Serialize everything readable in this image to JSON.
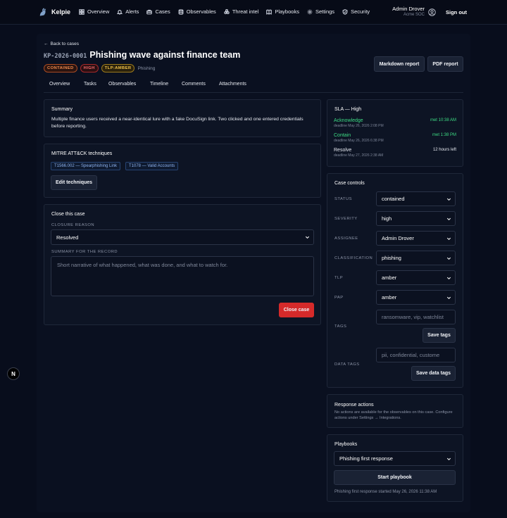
{
  "nav": {
    "brand": "Kelpie",
    "items": [
      {
        "label": "Overview",
        "icon": "grid-icon"
      },
      {
        "label": "Alerts",
        "icon": "bell-icon"
      },
      {
        "label": "Cases",
        "icon": "briefcase-icon"
      },
      {
        "label": "Observables",
        "icon": "database-icon"
      },
      {
        "label": "Threat intel",
        "icon": "biohazard-icon"
      },
      {
        "label": "Playbooks",
        "icon": "book-icon"
      },
      {
        "label": "Settings",
        "icon": "gear-icon"
      },
      {
        "label": "Security",
        "icon": "shield-icon"
      }
    ],
    "user_name": "Admin Drover",
    "user_org": "Acme SOC",
    "sign_out": "Sign out"
  },
  "case": {
    "back": "Back to cases",
    "id": "KP-2026-0001",
    "title": "Phishing wave against finance team",
    "badges": [
      "CONTAINED",
      "HIGH",
      "TLP:AMBER"
    ],
    "category": "Phishing"
  },
  "header_actions": {
    "markdown": "Markdown report",
    "pdf": "PDF report"
  },
  "tabs": [
    "Overview",
    "Tasks",
    "Observables",
    "Timeline",
    "Comments",
    "Attachments"
  ],
  "summary": {
    "title": "Summary",
    "text": "Multiple finance users received a near-identical lure with a fake DocuSign link. Two clicked and one entered credentials before reporting."
  },
  "mitre": {
    "title": "MITRE ATT&CK techniques",
    "chips": [
      "T1566.002 — Spearphishing Link",
      "T1078 — Valid Accounts"
    ],
    "edit_button": "Edit techniques"
  },
  "close_case": {
    "title": "Close this case",
    "reason_label": "CLOSURE REASON",
    "reason_value": "Resolved",
    "summary_label": "SUMMARY FOR THE RECORD",
    "summary_placeholder": "Short narrative of what happened, what was done, and what to watch for.",
    "button": "Close case"
  },
  "sla": {
    "title": "SLA — High",
    "rows": [
      {
        "name": "Acknowledge",
        "deadline": "deadline May 26, 2026 2:08 PM",
        "status": "met 10:38 AM"
      },
      {
        "name": "Contain",
        "deadline": "deadline May 26, 2026 6:38 PM",
        "status": "met 1:38 PM"
      },
      {
        "name": "Resolve",
        "deadline": "deadline May 27, 2026 2:38 AM",
        "status": "12 hours left"
      }
    ]
  },
  "controls": {
    "title": "Case controls",
    "status_label": "STATUS",
    "status_value": "contained",
    "severity_label": "SEVERITY",
    "severity_value": "high",
    "assignee_label": "ASSIGNEE",
    "assignee_value": "Admin Drover",
    "classification_label": "CLASSIFICATION",
    "classification_value": "phishing",
    "tlp_label": "TLP",
    "tlp_value": "amber",
    "pap_label": "PAP",
    "pap_value": "amber",
    "tags_label": "TAGS",
    "tags_placeholder": "ransomware, vip, watchlist",
    "save_tags": "Save tags",
    "data_tags_label": "DATA TAGS",
    "data_tags_placeholder": "pii, confidential, custome",
    "save_data_tags": "Save data tags"
  },
  "response": {
    "title": "Response actions",
    "text": "No actions are available for the observables on this case. Configure actions under Settings → Integrations."
  },
  "playbooks": {
    "title": "Playbooks",
    "selected": "Phishing first response",
    "start": "Start playbook",
    "note": "Phishing first response started May 26, 2026 11:38 AM"
  },
  "float_button": "N",
  "colors": {
    "accent_green": "#3ddc84",
    "danger": "#d52a2a",
    "background": "#080d1c"
  }
}
